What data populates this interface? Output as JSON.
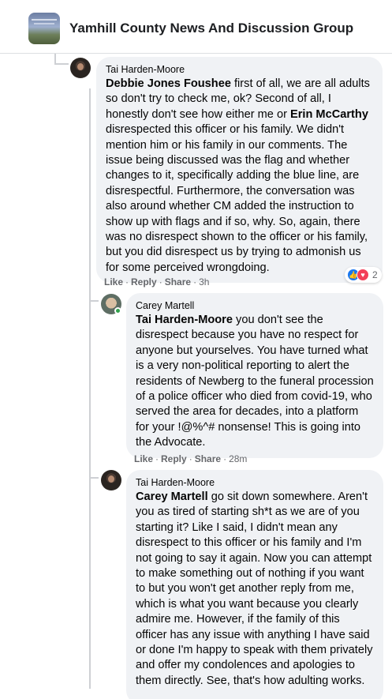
{
  "header": {
    "group_name": "Yamhill County News And Discussion Group",
    "group_icon": "group-cover-thumbnail"
  },
  "comments": [
    {
      "author": "Tai Harden-Moore",
      "mention": "Debbie Jones Foushee",
      "text_1": " first of all, we are all adults so don't try to check me, ok? Second of all, I honestly don't see how either me or ",
      "mention_2": "Erin McCarthy",
      "text_2": " disrespected this officer or his family. We didn't mention him or his family in our comments. The issue being discussed was the flag and whether changes to it, specifically adding the blue line, are disrespectful. Furthermore, the conversation was also around whether CM added the instruction to show up with flags and if so, why. So, again, there was no disrespect shown to the officer or his family, but you did disrespect us by trying to admonish us for some perceived wrongdoing.",
      "like": "Like",
      "reply": "Reply",
      "share": "Share",
      "time": "3h",
      "reactions": {
        "count": "2",
        "icons": [
          "like-icon",
          "love-icon"
        ]
      }
    },
    {
      "author": "Carey Martell",
      "mention": "Tai Harden-Moore",
      "text": " you don't see the disrespect because you have no respect for anyone but yourselves. You have turned what is a very non-political reporting to alert the residents of Newberg to the funeral procession of a police officer who died from covid-19, who served the area for decades, into a platform for your !@%^# nonsense! This is going into the Advocate.",
      "like": "Like",
      "reply": "Reply",
      "share": "Share",
      "time": "28m"
    },
    {
      "author": "Tai Harden-Moore",
      "mention": "Carey Martell",
      "text": " go sit down somewhere. Aren't you as tired of starting sh*t as we are of you starting it? Like I said, I didn't mean any disrespect to this officer or his family and I'm not going to say it again. Now you can attempt to make something out of nothing if you want to but you won't get another reply from me, which is what you want because you clearly admire me. However, if the family of this officer has any issue with anything I have said or done I'm happy to speak with them privately and offer my condolences and apologies to them directly. See, that's how adulting works."
    }
  ]
}
